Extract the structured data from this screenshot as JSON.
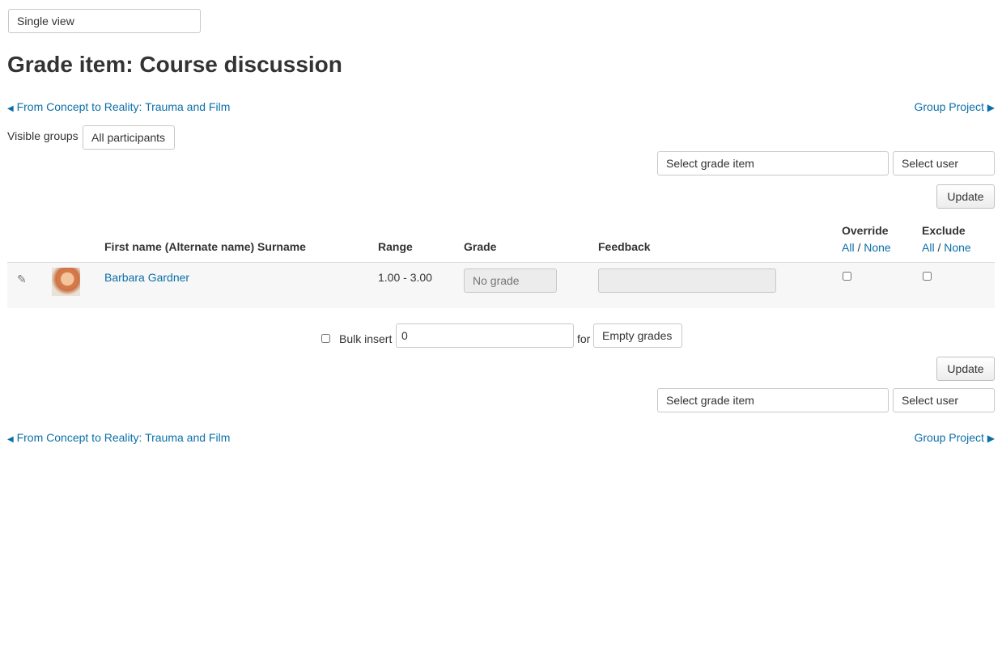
{
  "view_selector": {
    "value": "Single view"
  },
  "page_title": "Grade item: Course discussion",
  "nav": {
    "prev_label": "From Concept to Reality: Trauma and Film",
    "next_label": "Group Project",
    "prev_arrow": "◀",
    "next_arrow": "▶"
  },
  "groups": {
    "label": "Visible groups",
    "value": "All participants"
  },
  "selectors": {
    "grade_item": "Select grade item",
    "user": "Select user"
  },
  "update_label": "Update",
  "table": {
    "headers": {
      "name": "First name (Alternate name) Surname",
      "range": "Range",
      "grade": "Grade",
      "feedback": "Feedback",
      "override": "Override",
      "exclude": "Exclude"
    },
    "all_label": "All",
    "separator": "/",
    "none_label": "None",
    "rows": [
      {
        "name": "Barbara Gardner",
        "range": "1.00 - 3.00",
        "grade_placeholder": "No grade",
        "feedback": "",
        "override": false,
        "exclude": false
      }
    ]
  },
  "bulk": {
    "label": "Bulk insert",
    "value": "0",
    "for_label": "for",
    "target": "Empty grades"
  },
  "icons": {
    "edit": "pencil-icon",
    "avatar": "user-avatar"
  }
}
